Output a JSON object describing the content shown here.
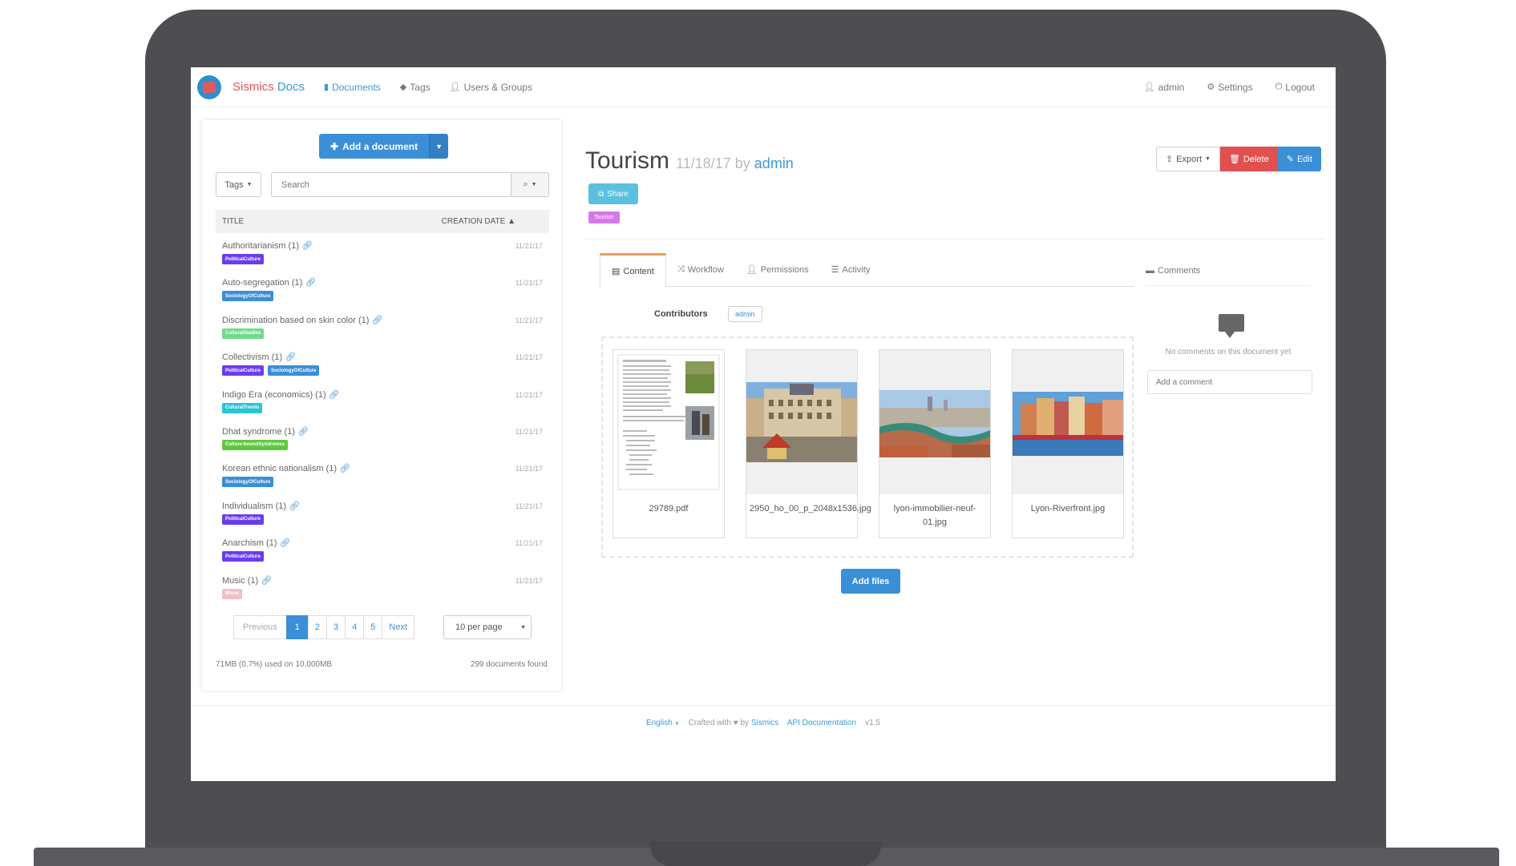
{
  "app": {
    "brand_part1": "Sismics",
    "brand_part2": "Docs"
  },
  "nav": {
    "documents": "Documents",
    "tags": "Tags",
    "users_groups": "Users & Groups",
    "admin": "admin",
    "settings": "Settings",
    "logout": "Logout"
  },
  "sidebar": {
    "add_document": "Add a document",
    "tags_button": "Tags",
    "search_placeholder": "Search",
    "col_title": "TITLE",
    "col_date": "CREATION DATE",
    "documents": [
      {
        "title": "Authoritarianism (1)",
        "date": "11/21/17",
        "tags": [
          {
            "label": "PoliticalCulture",
            "color": "#6a3cf0"
          }
        ]
      },
      {
        "title": "Auto-segregation (1)",
        "date": "11/21/17",
        "tags": [
          {
            "label": "SociologyOfCulture",
            "color": "#3a8fd6"
          }
        ]
      },
      {
        "title": "Discrimination based on skin color (1)",
        "date": "11/21/17",
        "tags": [
          {
            "label": "CulturalStudies",
            "color": "#6fdc8c"
          }
        ]
      },
      {
        "title": "Collectivism (1)",
        "date": "11/21/17",
        "tags": [
          {
            "label": "PoliticalCulture",
            "color": "#6a3cf0"
          },
          {
            "label": "SociologyOfCulture",
            "color": "#3a8fd6"
          }
        ]
      },
      {
        "title": "Indigo Era (economics) (1)",
        "date": "11/21/17",
        "tags": [
          {
            "label": "CulturalTrends",
            "color": "#2bc4d6"
          }
        ]
      },
      {
        "title": "Dhat syndrome (1)",
        "date": "11/21/17",
        "tags": [
          {
            "label": "Culture-boundSyndromes",
            "color": "#5fc93c"
          }
        ]
      },
      {
        "title": "Korean ethnic nationalism (1)",
        "date": "11/21/17",
        "tags": [
          {
            "label": "SociologyOfCulture",
            "color": "#3a8fd6"
          }
        ]
      },
      {
        "title": "Individualism (1)",
        "date": "11/21/17",
        "tags": [
          {
            "label": "PoliticalCulture",
            "color": "#6a3cf0"
          }
        ]
      },
      {
        "title": "Anarchism (1)",
        "date": "11/21/17",
        "tags": [
          {
            "label": "PoliticalCulture",
            "color": "#6a3cf0"
          }
        ]
      },
      {
        "title": "Music (1)",
        "date": "11/21/17",
        "tags": [
          {
            "label": "Music",
            "color": "#eec0c8"
          }
        ]
      }
    ],
    "pagination": {
      "previous": "Previous",
      "pages": [
        "1",
        "2",
        "3",
        "4",
        "5"
      ],
      "next": "Next",
      "per_page": "10 per page"
    },
    "usage": "71MB (0.7%) used on 10,000MB",
    "found": "299 documents found"
  },
  "document": {
    "title": "Tourism",
    "date": "11/18/17",
    "by": "by",
    "author": "admin",
    "share": "Share",
    "tag": {
      "label": "Tourism",
      "color": "#d679e8"
    },
    "export": "Export",
    "delete": "Delete",
    "edit": "Edit",
    "tabs": [
      "Content",
      "Workflow",
      "Permissions",
      "Activity"
    ],
    "contributors_label": "Contributors",
    "contributor": "admin",
    "files": [
      "29789.pdf",
      "2950_ho_00_p_2048x1536.jpg",
      "lyon-immobilier-neuf-01.jpg",
      "Lyon-Riverfront.jpg"
    ],
    "add_files": "Add files"
  },
  "comments": {
    "title": "Comments",
    "empty": "No comments on this document yet",
    "placeholder": "Add a comment"
  },
  "footer": {
    "language": "English",
    "crafted": "Crafted with",
    "by": "by",
    "sismics": "Sismics",
    "api": "API Documentation",
    "version": "v1.5"
  },
  "colors": {
    "accent": "#3a8fd6",
    "brand_red": "#e8534f",
    "delete": "#e05050",
    "share": "#5bc0de",
    "frame": "#4e4e52"
  }
}
